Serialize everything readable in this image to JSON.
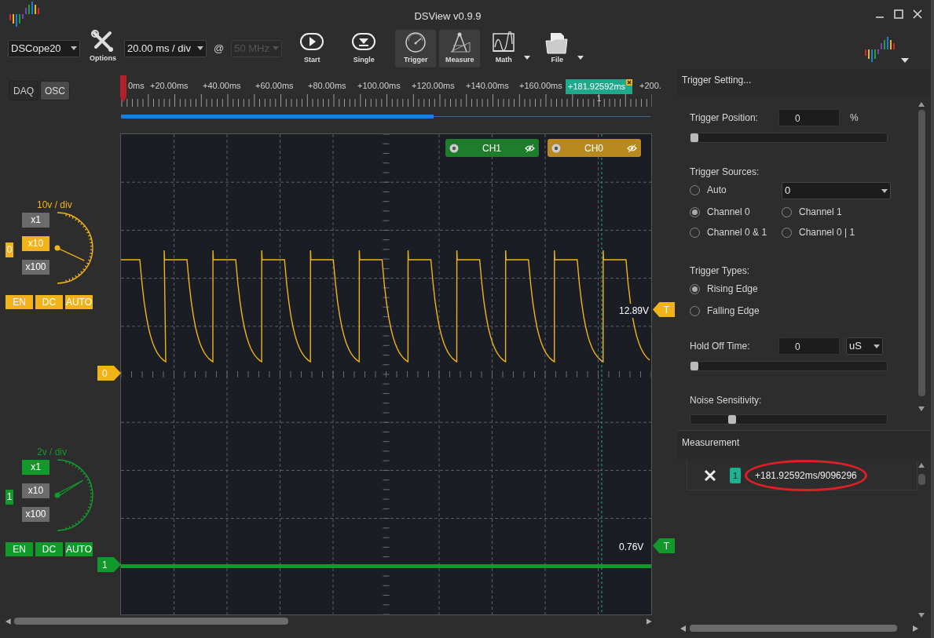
{
  "window": {
    "title": "DSView v0.9.9"
  },
  "toolbar": {
    "device": "DSCope20",
    "options": {
      "label": "Options"
    },
    "timebase": "20.00 ms / div",
    "at": "@",
    "sample_rate": {
      "value": "50 MHz",
      "disabled": true
    },
    "buttons": [
      {
        "kind": "start",
        "label": "Start",
        "selected": false,
        "menu": false
      },
      {
        "kind": "single",
        "label": "Single",
        "selected": false,
        "menu": false
      },
      {
        "kind": "trigger",
        "label": "Trigger",
        "selected": true,
        "menu": false
      },
      {
        "kind": "measure",
        "label": "Measure",
        "selected": true,
        "menu": false
      },
      {
        "kind": "math",
        "label": "Math",
        "selected": false,
        "menu": true
      },
      {
        "kind": "file",
        "label": "File",
        "selected": false,
        "menu": true
      }
    ]
  },
  "mode_tabs": [
    {
      "label": "DAQ",
      "selected": false
    },
    {
      "label": "OSC",
      "selected": true
    }
  ],
  "channels": [
    {
      "index": "0",
      "scale": "10v / div",
      "color": "#f0b41a",
      "marker": "0",
      "trigger_level": "12.89V",
      "trigger_tag": "T",
      "probes": [
        {
          "label": "x1",
          "selected": false
        },
        {
          "label": "x10",
          "selected": true
        },
        {
          "label": "x100",
          "selected": false
        }
      ],
      "buttons": [
        "EN",
        "DC",
        "AUTO"
      ]
    },
    {
      "index": "1",
      "scale": "2v / div",
      "color": "#119a2b",
      "marker": "1",
      "trigger_level": "0.76V",
      "trigger_tag": "T",
      "probes": [
        {
          "label": "x1",
          "selected": true
        },
        {
          "label": "x10",
          "selected": false
        },
        {
          "label": "x100",
          "selected": false
        }
      ],
      "buttons": [
        "EN",
        "DC",
        "AUTO"
      ]
    }
  ],
  "ruler": {
    "labels": [
      "0ms",
      "+20.00ms",
      "+40.00ms",
      "+60.00ms",
      "+80.00ms",
      "+100.00ms",
      "+120.00ms",
      "+140.00ms",
      "+160.00ms",
      "+200."
    ]
  },
  "plot_tags": [
    {
      "name": "CH1",
      "color": "#1e7d2a"
    },
    {
      "name": "CH0",
      "color": "#b8891e"
    }
  ],
  "cursor": {
    "label": "+181.92592ms",
    "index": "1"
  },
  "trigger_panel": {
    "title": "Trigger Setting...",
    "position": {
      "label": "Trigger Position:",
      "value": "0",
      "unit": "%",
      "level": 0
    },
    "sources": {
      "label": "Trigger Sources:",
      "select": "0",
      "options": [
        {
          "label": "Auto",
          "selected": false
        },
        {
          "label": "Channel 0",
          "selected": true
        },
        {
          "label": "Channel 1",
          "selected": false
        },
        {
          "label": "Channel 0 & 1",
          "selected": false
        },
        {
          "label": "Channel 0 | 1",
          "selected": false
        }
      ]
    },
    "types": {
      "label": "Trigger Types:",
      "options": [
        {
          "label": "Rising Edge",
          "selected": true
        },
        {
          "label": "Falling Edge",
          "selected": false
        }
      ]
    },
    "hold_off": {
      "label": "Hold Off Time:",
      "value": "0",
      "unit": "uS",
      "level": 0
    },
    "noise": {
      "label": "Noise Sensitivity:",
      "level": 0.2
    }
  },
  "measurement": {
    "title": "Measurement",
    "items": [
      {
        "index": "1",
        "value": "+181.92592ms/9096296",
        "highlighted": true
      }
    ]
  }
}
